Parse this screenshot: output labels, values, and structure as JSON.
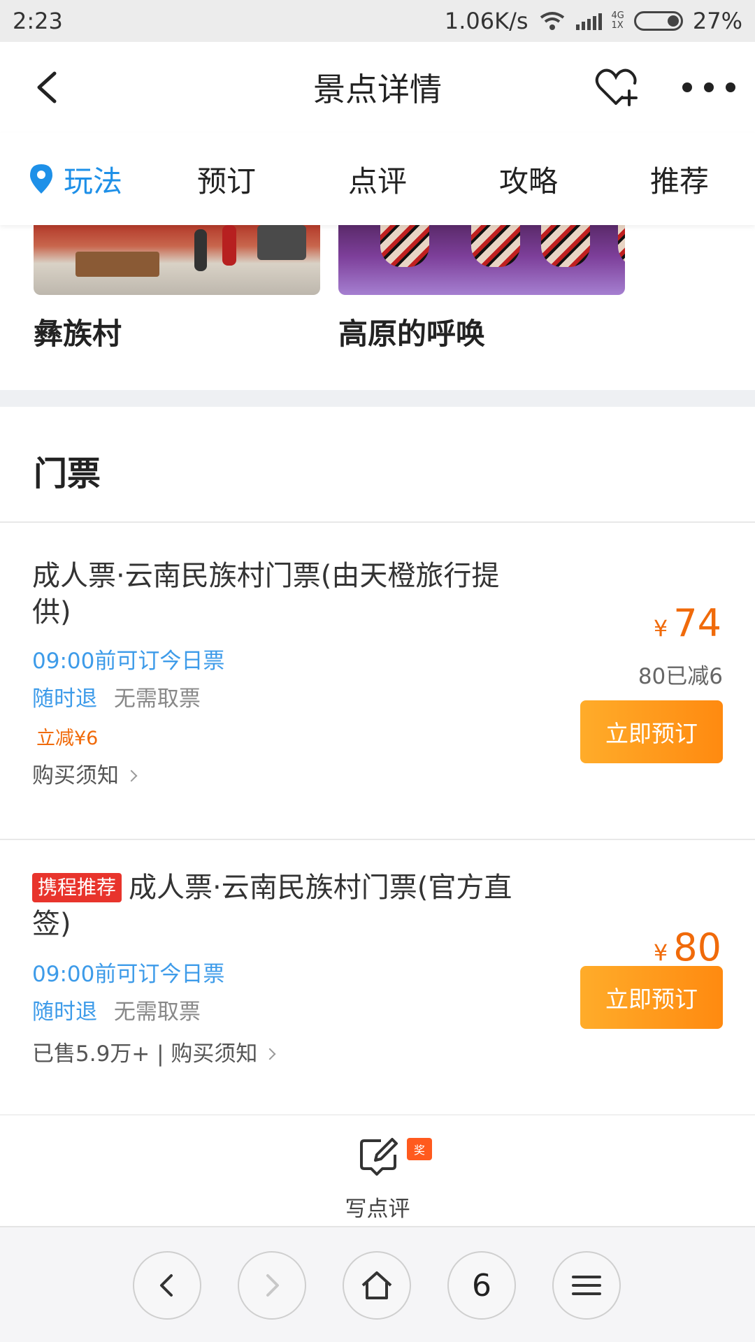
{
  "status_bar": {
    "time": "2:23",
    "net_speed": "1.06K/s",
    "net_type_top": "4G",
    "net_type_bottom": "1X",
    "battery": "27%"
  },
  "header": {
    "title": "景点详情",
    "back_icon": "chevron-left-icon",
    "favorite_icon": "heart-plus-icon",
    "more_icon": "more-dots-icon"
  },
  "tabs": [
    {
      "label": "玩法",
      "active": true
    },
    {
      "label": "预订",
      "active": false
    },
    {
      "label": "点评",
      "active": false
    },
    {
      "label": "攻略",
      "active": false
    },
    {
      "label": "推荐",
      "active": false
    }
  ],
  "attractions": [
    {
      "name": "彝族村"
    },
    {
      "name": "高原的呼唤"
    }
  ],
  "tickets_section": {
    "title": "门票",
    "tickets": [
      {
        "badge": "",
        "name": "成人票·云南民族村门票(由天橙旅行提供)",
        "book_time": "09:00前可订今日票",
        "refund": "随时退",
        "pickup": "无需取票",
        "discount": "立减¥6",
        "notes": "购买须知",
        "currency": "¥",
        "price": "74",
        "original_price_note": "80已减6",
        "book_label": "立即预订"
      },
      {
        "badge": "携程推荐",
        "name": "成人票·云南民族村门票(官方直签)",
        "book_time": "09:00前可订今日票",
        "refund": "随时退",
        "pickup": "无需取票",
        "notes": "已售5.9万+ | 购买须知",
        "currency": "¥",
        "price": "80",
        "book_label": "立即预订"
      }
    ]
  },
  "review": {
    "label": "写点评",
    "award_badge": "奖",
    "icon": "edit-note-icon"
  },
  "browser_nav": {
    "tab_count": "6",
    "icons": [
      "back-arrow-icon",
      "forward-arrow-icon",
      "home-icon",
      "tabs-count",
      "menu-icon"
    ]
  },
  "colors": {
    "accent_blue": "#1e90e8",
    "price_orange": "#f06a0a",
    "button_orange": "#ff8a10",
    "badge_red": "#e8342c"
  }
}
